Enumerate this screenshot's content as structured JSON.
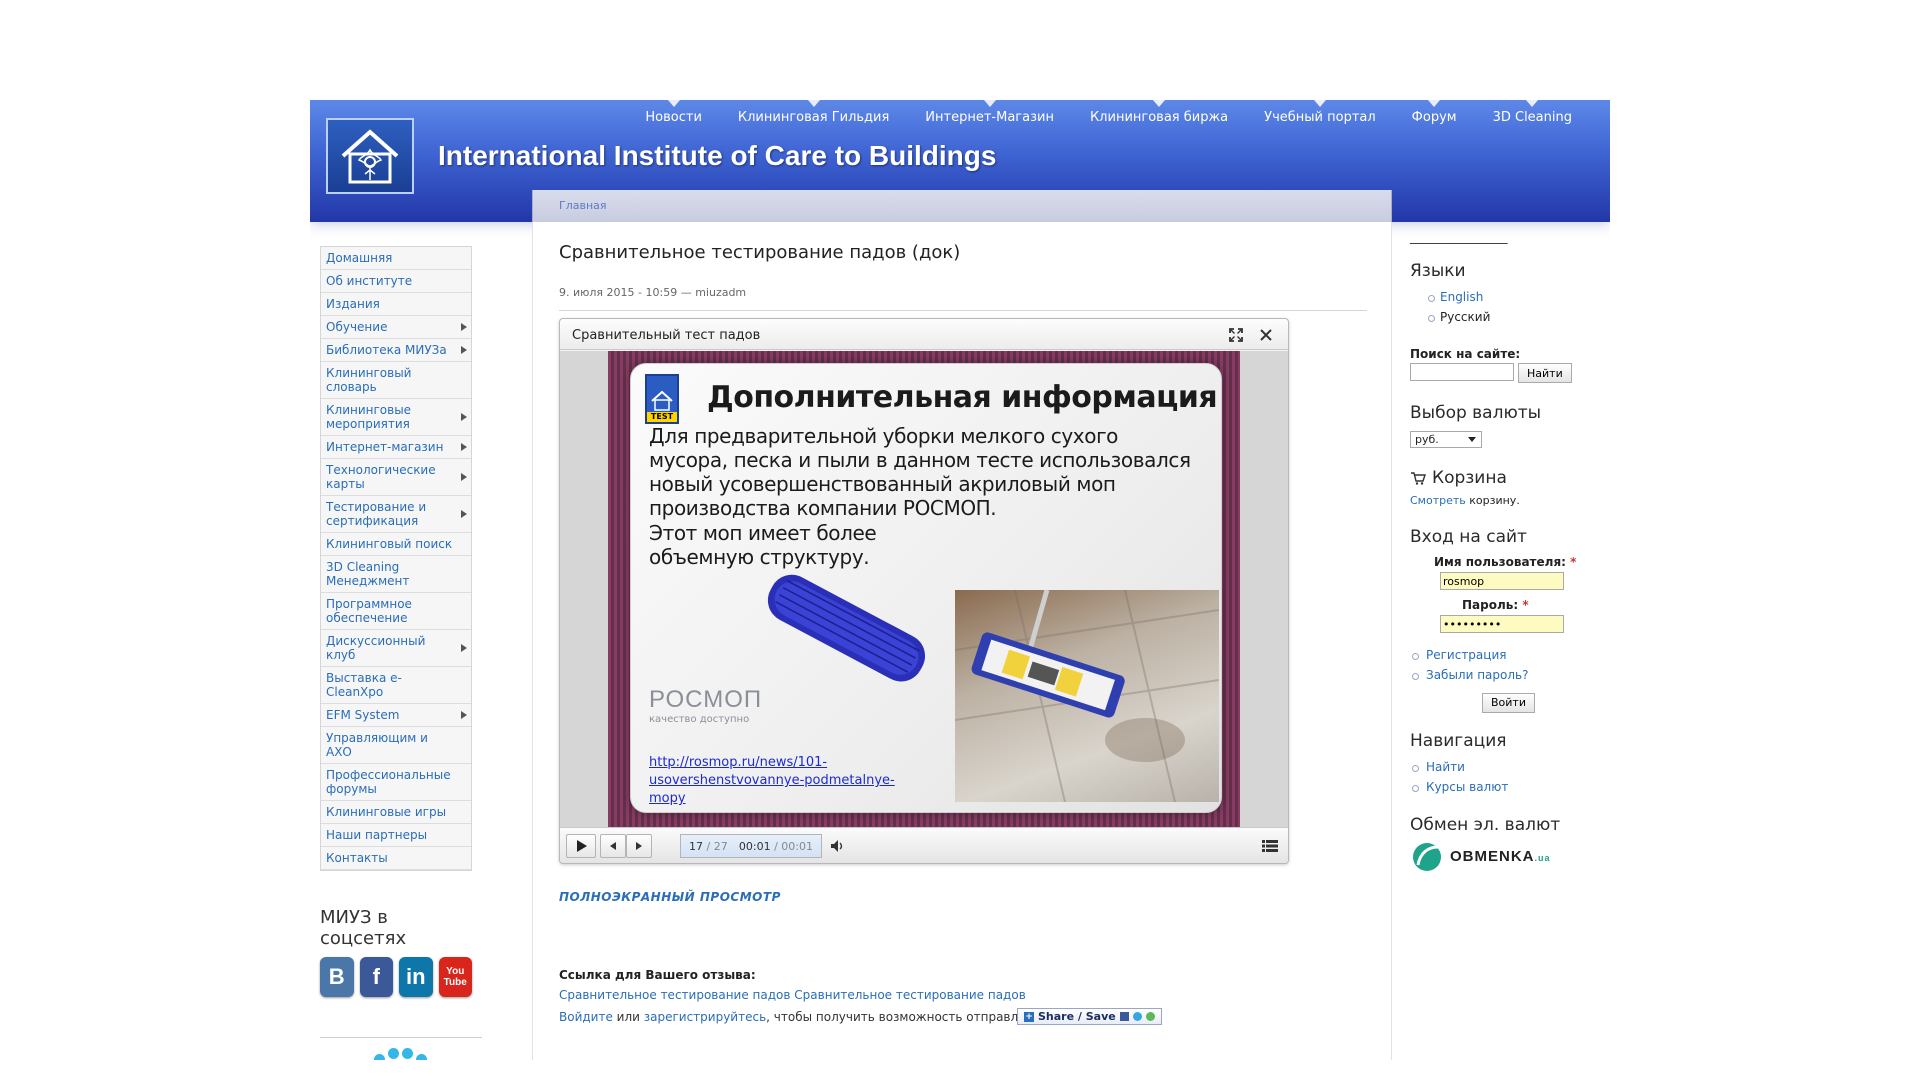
{
  "header": {
    "site_title": "International Institute of Care to Buildings",
    "nav": [
      "Новости",
      "Клининговая Гильдия",
      "Интернет-Магазин",
      "Клининговая биржа",
      "Учебный портал",
      "Форум",
      "3D Cleaning"
    ],
    "breadcrumb": "Главная"
  },
  "left_menu": [
    {
      "label": "Домашняя",
      "has_sub": false
    },
    {
      "label": "Об институте",
      "has_sub": false
    },
    {
      "label": "Издания",
      "has_sub": false
    },
    {
      "label": "Обучение",
      "has_sub": true
    },
    {
      "label": "Библиотека МИУЗа",
      "has_sub": true
    },
    {
      "label": "Клининговый словарь",
      "has_sub": false
    },
    {
      "label": "Клининговые мероприятия",
      "has_sub": true
    },
    {
      "label": "Интернет-магазин",
      "has_sub": true
    },
    {
      "label": "Технологические карты",
      "has_sub": true
    },
    {
      "label": "Тестирование и сертификация",
      "has_sub": true
    },
    {
      "label": "Клининговый поиск",
      "has_sub": false
    },
    {
      "label": "3D Cleaning Менеджмент",
      "has_sub": false
    },
    {
      "label": "Программное обеспечение",
      "has_sub": false
    },
    {
      "label": "Дискуссионный клуб",
      "has_sub": true
    },
    {
      "label": "Выставка e-CleanXpo",
      "has_sub": false
    },
    {
      "label": "EFM System",
      "has_sub": true
    },
    {
      "label": "Управляющим и АХО",
      "has_sub": false
    },
    {
      "label": "Профессиональные форумы",
      "has_sub": false
    },
    {
      "label": "Клининговые игры",
      "has_sub": false
    },
    {
      "label": "Наши партнеры",
      "has_sub": false
    },
    {
      "label": "Контакты",
      "has_sub": false
    }
  ],
  "social": {
    "title": "МИУЗ в соцсетях",
    "icons": [
      {
        "name": "vk",
        "glyph": "B",
        "color": "#4a76a8"
      },
      {
        "name": "facebook",
        "glyph": "f",
        "color": "#3b5998"
      },
      {
        "name": "linkedin",
        "glyph": "in",
        "color": "#0e76a8"
      },
      {
        "name": "youtube",
        "glyph": "You\nTube",
        "color": "#d9261c"
      }
    ]
  },
  "article": {
    "title": "Сравнительное тестирование падов (док)",
    "meta": "9. июля 2015 - 10:59 — miuzadm",
    "fullscreen": "ПОЛНОЭКРАННЫЙ ПРОСМОТР",
    "feedback_label": "Ссылка для Вашего отзыва:",
    "feedback_link1": "Сравнительное тестирование падов",
    "feedback_link2": "Сравнительное тестирование падов",
    "login_link": "Войдите",
    "or_text": " или ",
    "register_link": "зарегистрируйтесь",
    "comment_text": ", чтобы получить возможность отправлять комментарии",
    "share_label": "Share / Save"
  },
  "viewer": {
    "title": "Сравнительный тест падов",
    "slide": {
      "logo_tag": "TEST",
      "heading": "Дополнительная информация",
      "lines": [
        "Для предварительной уборки мелкого сухого",
        "мусора, песка и пыли в данном тесте использовался",
        "новый усовершенствованный акриловый моп",
        "производства компании РОСМОП.",
        "Этот моп имеет более",
        "объемную структуру."
      ],
      "brand": "РОСМОП",
      "brand_sub": "качество доступно",
      "link_line1": "http://rosmop.ru/news/101-",
      "link_line2": "usovershenstvovannye-podmetalnye-mopy"
    },
    "slide_current": "17",
    "slide_total": "/ 27",
    "time_current": "00:01",
    "time_total": "/ 00:01"
  },
  "right": {
    "dashes": "_______________",
    "languages_title": "Языки",
    "languages": [
      "English",
      "Русский"
    ],
    "search_label": "Поиск на сайте:",
    "search_button": "Найти",
    "currency_title": "Выбор валюты",
    "currency_value": "руб.",
    "cart_title": "Корзина",
    "cart_link": "Смотреть",
    "cart_text": " корзину.",
    "login_title": "Вход на сайт",
    "username_label": "Имя пользователя:",
    "username_value": "rosmop",
    "password_label": "Пароль:",
    "password_value": "•••••••••",
    "login_links": [
      "Регистрация",
      "Забыли пароль?"
    ],
    "login_button": "Войти",
    "nav_title": "Навигация",
    "nav_links": [
      "Найти",
      "Курсы валют"
    ],
    "exchange_title": "Обмен эл. валют",
    "exchange_brand": "OBMENKA",
    "exchange_brand_suffix": ".ua"
  }
}
